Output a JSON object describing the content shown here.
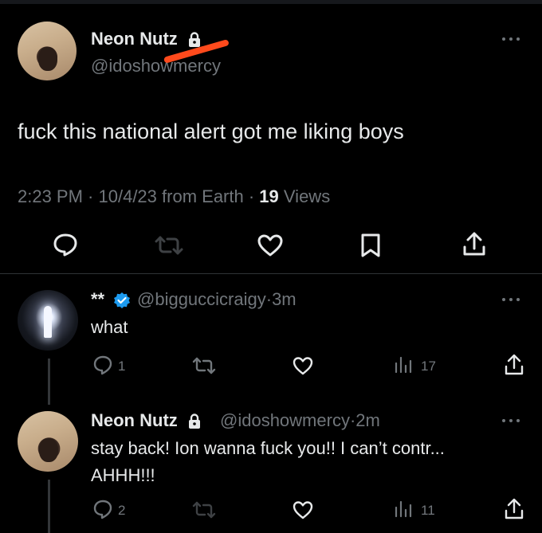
{
  "main_tweet": {
    "name": "Neon Nutz",
    "handle": "@idoshowmercy",
    "text": "fuck this national alert got me liking boys",
    "time": "2:23 PM",
    "date": "10/4/23",
    "source": "from Earth",
    "views_count": "19",
    "views_label": "Views",
    "actions": [
      "reply-icon",
      "retweet-icon",
      "like-icon",
      "bookmark-icon",
      "share-icon"
    ]
  },
  "replies": [
    {
      "name": "**",
      "verified": true,
      "handle": "@bigguccicraigy",
      "age": "3m",
      "text": "what",
      "reply_count": "1",
      "views_count": "17"
    },
    {
      "name": "Neon Nutz",
      "handle": "@idoshowmercy",
      "age": "2m",
      "text_line1": "stay back! Ion wanna fuck you!! I can’t contr...",
      "text_line2": "AHHH!!!",
      "reply_count": "2",
      "views_count": "11"
    }
  ],
  "colors": {
    "background": "#000000",
    "text": "#e7e9ea",
    "muted": "#71767b",
    "verified": "#1d9bf0",
    "annotation": "#ff4a1c"
  }
}
